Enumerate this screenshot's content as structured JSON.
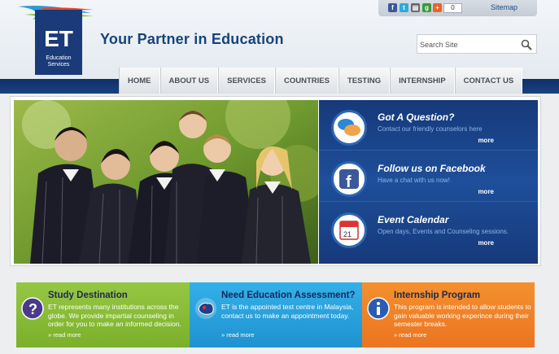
{
  "header": {
    "logo_letters": "ET",
    "logo_subtitle": "Education Services",
    "tagline": "Your Partner in Education",
    "social_count": "0",
    "sitemap_label": "Sitemap",
    "social_icons": [
      "facebook-icon",
      "twitter-icon",
      "print-icon",
      "google-icon",
      "share-icon"
    ]
  },
  "search": {
    "placeholder": "Search Site"
  },
  "nav": {
    "items": [
      {
        "label": "HOME"
      },
      {
        "label": "ABOUT US"
      },
      {
        "label": "SERVICES"
      },
      {
        "label": "COUNTRIES"
      },
      {
        "label": "TESTING"
      },
      {
        "label": "INTERNSHIP"
      },
      {
        "label": "CONTACT US"
      }
    ]
  },
  "side_panel": {
    "items": [
      {
        "title": "Got A Question?",
        "desc": "Contact our friendly counselors here",
        "more": "more",
        "icon": "chat-bubbles-icon"
      },
      {
        "title": "Follow us on Facebook",
        "desc": "Have a chat with us now!",
        "more": "more",
        "icon": "facebook-icon"
      },
      {
        "title": "Event Calendar",
        "desc": "Open days, Events and Counseling sessions.",
        "more": "more",
        "icon": "calendar-icon"
      }
    ],
    "calendar_day": "21"
  },
  "boxes": [
    {
      "title": "Study Destination",
      "text": "ET represents many institutions across the globe. We provide impartial counseling in order for you to make an informed decision.",
      "more": "» read more",
      "icon": "question-icon",
      "color": "#86b935"
    },
    {
      "title": "Need Education Assessment?",
      "text": "ET is the appointed test centre in Malaysia, contact us to make an appointment today.",
      "more": "» read more",
      "icon": "australia-map-icon",
      "color": "#27a2de"
    },
    {
      "title": "Internship Program",
      "text": "This program is intended to allow students to gain valuable working experince during their semester breaks.",
      "more": "» read more",
      "icon": "info-icon",
      "color": "#f07f26"
    }
  ],
  "colors": {
    "brand_blue": "#17447e",
    "dark_band": "#0f2f66",
    "side_panel": "#1e4f9a"
  }
}
